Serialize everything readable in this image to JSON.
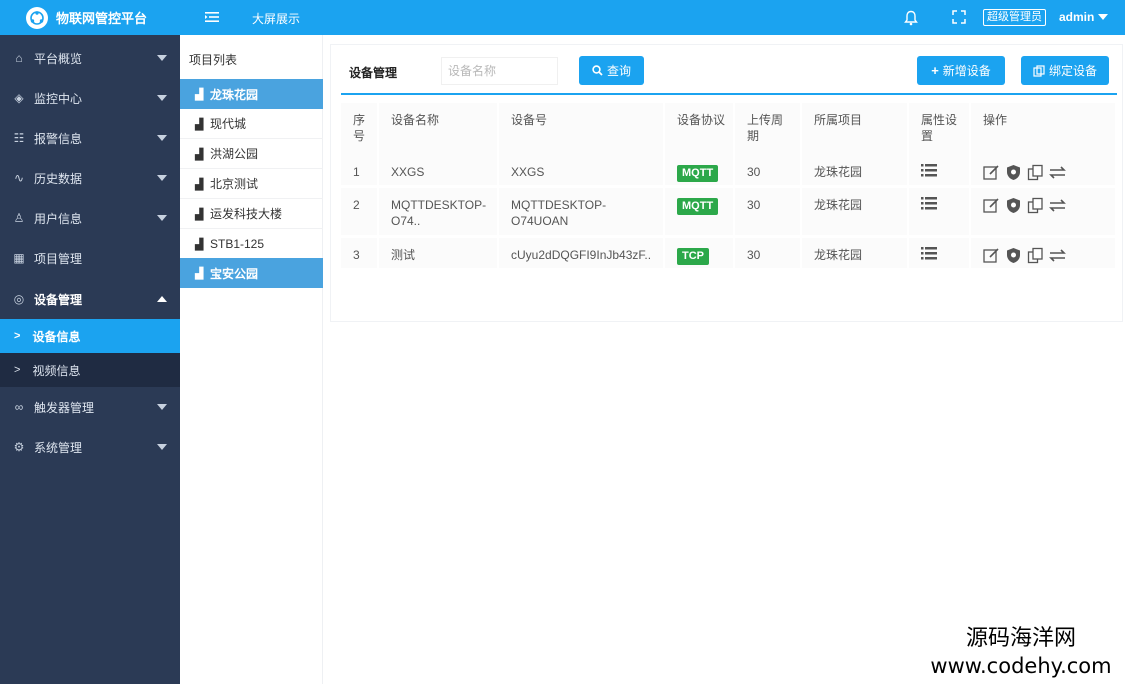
{
  "app": {
    "title": "物联网管控平台",
    "bigscreen": "大屏展示",
    "role": "超级管理员",
    "user": "admin"
  },
  "sidebar": {
    "items": [
      {
        "label": "平台概览",
        "icon": "home-icon"
      },
      {
        "label": "监控中心",
        "icon": "cube-icon"
      },
      {
        "label": "报警信息",
        "icon": "bars-icon"
      },
      {
        "label": "历史数据",
        "icon": "pulse-icon"
      },
      {
        "label": "用户信息",
        "icon": "user-icon"
      },
      {
        "label": "项目管理",
        "icon": "project-icon"
      },
      {
        "label": "设备管理",
        "icon": "device-icon"
      },
      {
        "label": "触发器管理",
        "icon": "link-icon"
      },
      {
        "label": "系统管理",
        "icon": "gear-icon"
      }
    ],
    "sub_items": [
      {
        "label": "设备信息",
        "active": true
      },
      {
        "label": "视频信息",
        "active": false
      }
    ]
  },
  "projects": {
    "header": "项目列表",
    "items": [
      {
        "label": "龙珠花园",
        "highlight": true
      },
      {
        "label": "现代城",
        "highlight": false
      },
      {
        "label": "洪湖公园",
        "highlight": false
      },
      {
        "label": "北京测试",
        "highlight": false
      },
      {
        "label": "运发科技大楼",
        "highlight": false
      },
      {
        "label": "STB1-125",
        "highlight": false
      },
      {
        "label": "宝安公园",
        "highlight": true
      }
    ]
  },
  "main": {
    "title": "设备管理",
    "search_placeholder": "设备名称",
    "query_label": "查询",
    "add_label": "新增设备",
    "bind_label": "绑定设备",
    "columns": [
      "序号",
      "设备名称",
      "设备号",
      "设备协议",
      "上传周期",
      "所属项目",
      "属性设置",
      "操作"
    ],
    "rows": [
      {
        "idx": "1",
        "name": "XXGS",
        "no": "XXGS",
        "protocol": "MQTT",
        "period": "30",
        "project": "龙珠花园"
      },
      {
        "idx": "2",
        "name": "MQTTDESKTOP-O74..",
        "no": "MQTTDESKTOP-O74UOAN",
        "protocol": "MQTT",
        "period": "30",
        "project": "龙珠花园"
      },
      {
        "idx": "3",
        "name": "测试",
        "no": "cUyu2dDQGFI9InJb43zF..",
        "protocol": "TCP",
        "period": "30",
        "project": "龙珠花园"
      }
    ]
  },
  "watermark": {
    "line1": "源码海洋网",
    "line2": "www.codehy.com"
  },
  "colors": {
    "primary": "#1ba3f0",
    "sidebar": "#2b3a55",
    "protocol_badge": "#2ca84a"
  }
}
